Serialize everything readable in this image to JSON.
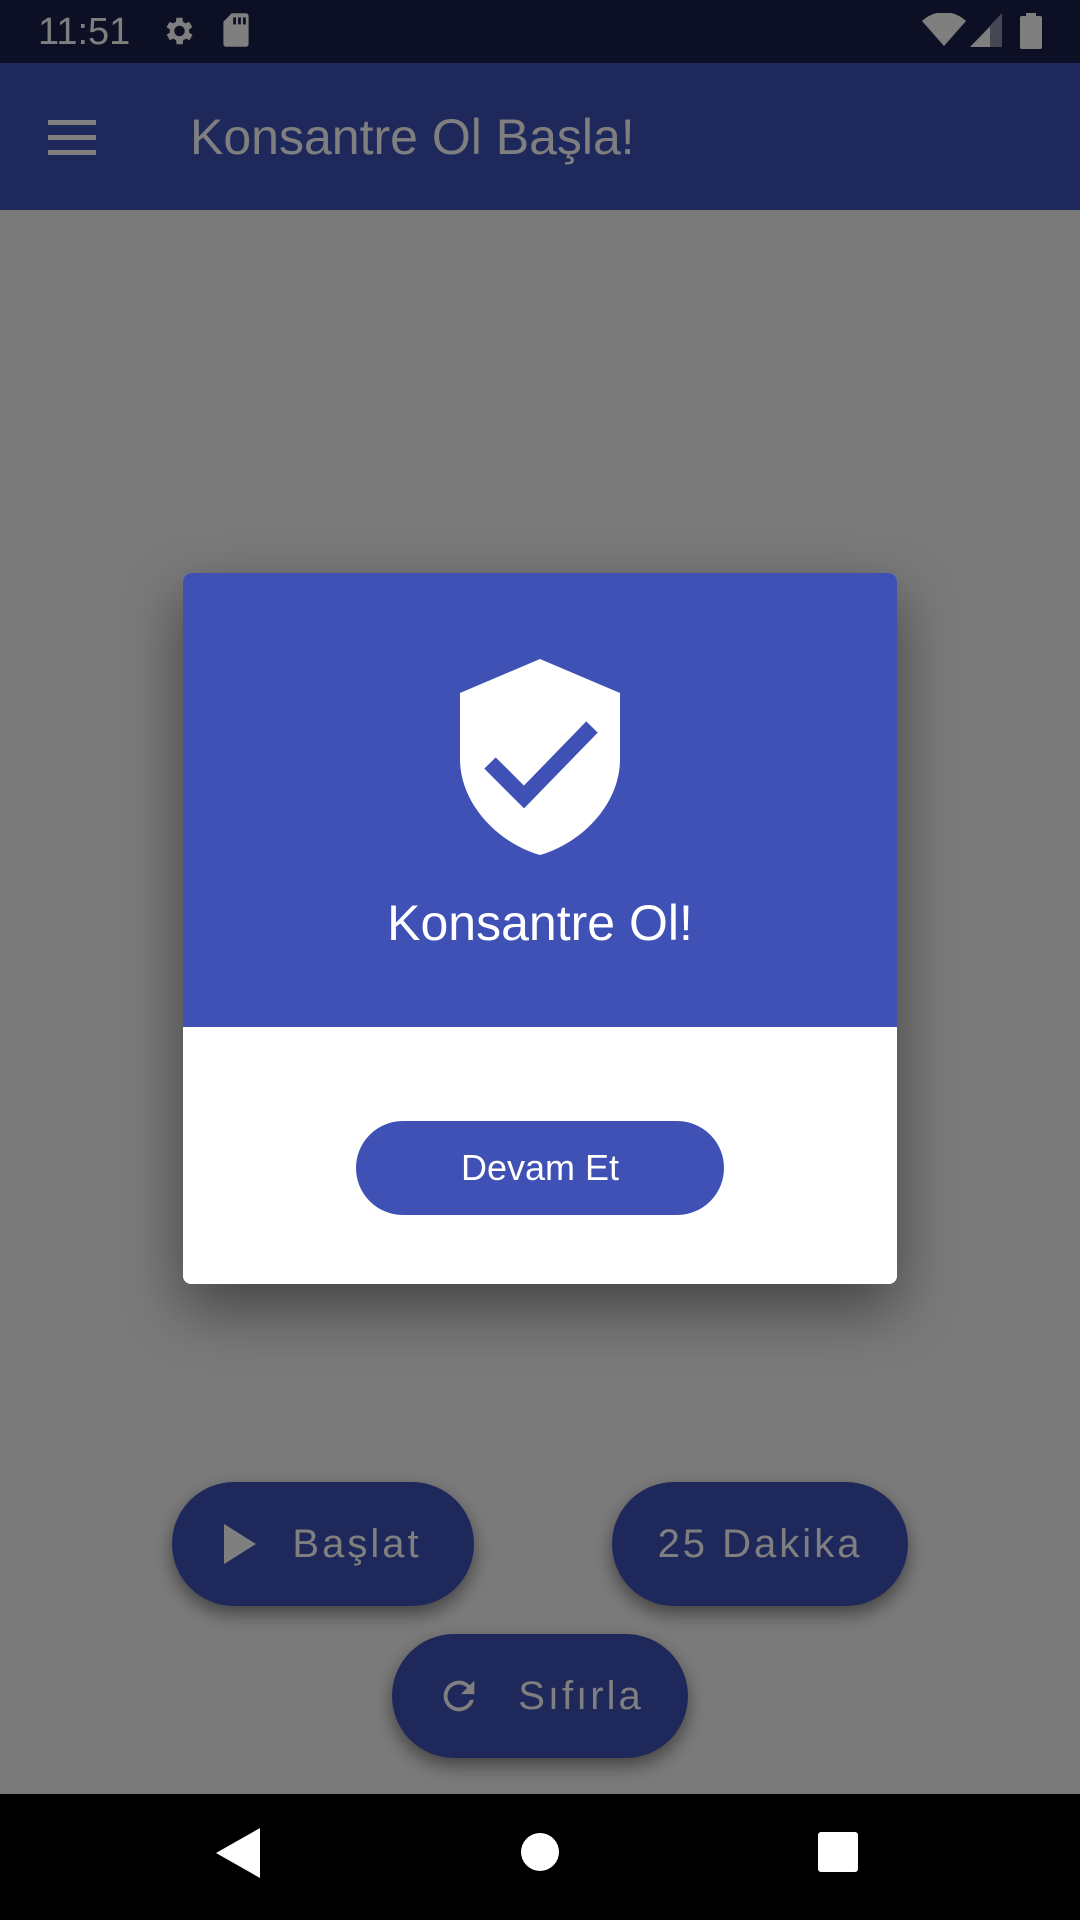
{
  "status_bar": {
    "time": "11:51",
    "icons": [
      "settings-icon",
      "sd-card-icon",
      "wifi-icon",
      "signal-icon",
      "battery-icon"
    ]
  },
  "app_bar": {
    "title": "Konsantre Ol Başla!",
    "menu_icon": "hamburger-menu-icon"
  },
  "controls": {
    "start_label": "Başlat",
    "duration_label": "25 Dakika",
    "reset_label": "Sıfırla"
  },
  "dialog": {
    "icon": "shield-check-icon",
    "title": "Konsantre Ol!",
    "button_label": "Devam Et"
  },
  "nav_bar": {
    "icons": [
      "back-icon",
      "home-icon",
      "recents-icon"
    ]
  },
  "colors": {
    "primary": "#3f51b5",
    "status_bar": "#1a1f48",
    "scrim": "rgba(0,0,0,0.5)"
  }
}
